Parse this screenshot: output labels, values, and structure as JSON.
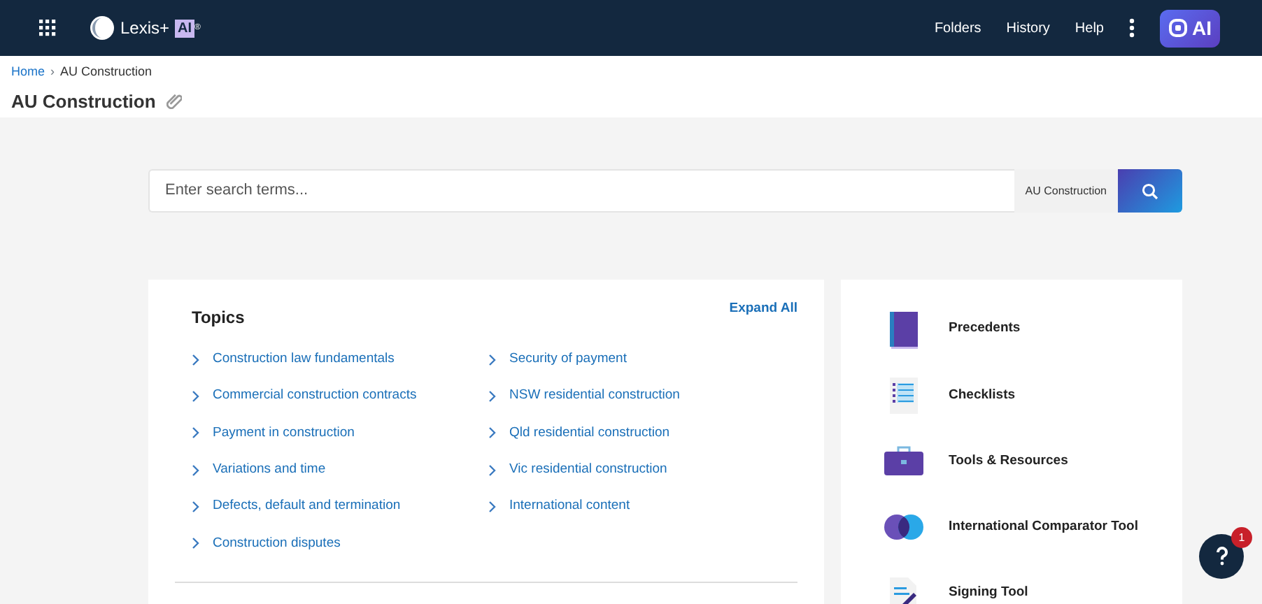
{
  "navbar": {
    "logo_text": "Lexis+",
    "logo_badge": "AI",
    "logo_mark": "®",
    "links": [
      "Folders",
      "History",
      "Help"
    ],
    "ai_button": "AI"
  },
  "breadcrumb": [
    {
      "label": "Home",
      "link": true
    },
    {
      "label": "AU Construction",
      "link": false
    }
  ],
  "breadcrumb_separator": "›",
  "page_title": "AU Construction",
  "search": {
    "placeholder": "Enter search terms...",
    "scope": "AU Construction"
  },
  "topics": {
    "title": "Topics",
    "expand_all": "Expand All",
    "columns": [
      [
        "Construction law fundamentals",
        "Commercial construction contracts",
        "Payment in construction",
        "Variations and time",
        "Defects, default and termination",
        "Construction disputes"
      ],
      [
        "Security of payment",
        "NSW residential construction",
        "Qld residential construction",
        "Vic residential construction",
        "International content"
      ]
    ]
  },
  "tools": [
    {
      "label": "Precedents",
      "kind": "book"
    },
    {
      "label": "Checklists",
      "kind": "checklist"
    },
    {
      "label": "Tools & Resources",
      "kind": "briefcase"
    },
    {
      "label": "International Comparator Tool",
      "kind": "circles"
    },
    {
      "label": "Signing Tool",
      "kind": "signing"
    }
  ],
  "help": {
    "badge": "1"
  }
}
